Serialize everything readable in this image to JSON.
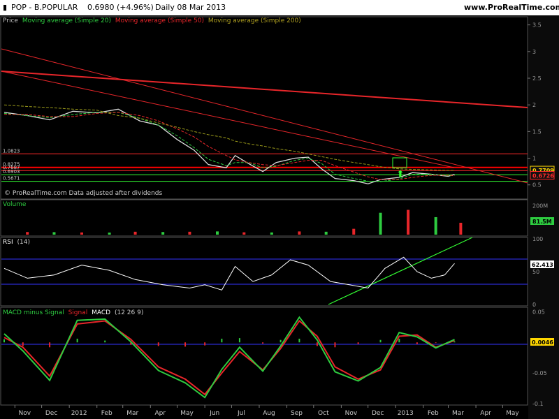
{
  "topbar": {
    "symbol": "POP - B.POPULAR",
    "last": "0.6980 (+4.96%)",
    "period_date": "Daily  08 Mar 2013",
    "site": "www.ProRealTime.com"
  },
  "price_panel": {
    "title_price": "Price",
    "title_ma20": "Moving average (Simple 20)",
    "title_ma50": "Moving average (Simple 50)",
    "title_ma200": "Moving average (Simple 200)",
    "footer": "© ProRealTime.com  Data adjusted after dividends",
    "y_ticks": [
      "3.5",
      "3",
      "2.5",
      "2",
      "1.5",
      "1",
      "0.5"
    ],
    "hlines": [
      {
        "label": "1.0823",
        "value": 1.0823,
        "color": "#ff2a2a"
      },
      {
        "label": "0.8275",
        "value": 0.8275,
        "color": "#ff0000"
      },
      {
        "label": "0.7687",
        "value": 0.7687,
        "color": "#ff2a2a"
      },
      {
        "label": "0.6903",
        "value": 0.6903,
        "color": "#33ff33"
      },
      {
        "label": "0.5671",
        "value": 0.5671,
        "color": "#33ff33"
      }
    ],
    "badges": [
      {
        "text": "0.7709",
        "value": 0.7709,
        "color": "#ffd700"
      },
      {
        "text": "0.6726",
        "value": 0.6726,
        "color": "#ff2a2a"
      }
    ],
    "colors": {
      "ma20": "#2ecc40",
      "ma50": "#e8262a",
      "ma200": "#9a9a1a",
      "price": "#dddddd"
    }
  },
  "volume_panel": {
    "title": "Volume",
    "y_ticks": [
      "200M"
    ],
    "badge": "81.5M"
  },
  "rsi_panel": {
    "title": "RSI",
    "param": "(14)",
    "y_ticks": [
      "100",
      "50",
      "0"
    ],
    "badge": "62.413"
  },
  "macd_panel": {
    "title_hist": "MACD minus Signal",
    "title_signal": "Signal",
    "title_macd": "MACD",
    "param": "(12 26 9)",
    "y_ticks": [
      "0.05",
      "0",
      "-0.05",
      "-0.1"
    ],
    "badge": "0.0046"
  },
  "x_axis": {
    "labels": [
      "Nov",
      "Dec",
      "2012",
      "Feb",
      "Mar",
      "Apr",
      "May",
      "Jun",
      "Jul",
      "Aug",
      "Sep",
      "Oct",
      "Nov",
      "Dec",
      "2013",
      "Feb",
      "Mar",
      "Apr",
      "May"
    ]
  },
  "chart_data": [
    {
      "type": "line",
      "title": "",
      "xlabel": "",
      "ylabel": "",
      "ylim": [
        0.3,
        3.6
      ],
      "x": [
        "2011-10-20",
        "2011-11-15",
        "2011-12-10",
        "2012-01-05",
        "2012-02-01",
        "2012-02-25",
        "2012-03-20",
        "2012-04-10",
        "2012-05-01",
        "2012-05-20",
        "2012-06-05",
        "2012-06-25",
        "2012-07-05",
        "2012-07-20",
        "2012-08-05",
        "2012-08-20",
        "2012-09-10",
        "2012-09-25",
        "2012-10-10",
        "2012-10-25",
        "2012-11-15",
        "2012-12-01",
        "2012-12-15",
        "2013-01-05",
        "2013-01-20",
        "2013-02-10",
        "2013-03-01",
        "2013-03-08"
      ],
      "series": [
        {
          "values": [
            1.86,
            1.8,
            1.72,
            1.88,
            1.85,
            1.92,
            1.7,
            1.62,
            1.35,
            1.15,
            0.88,
            0.82,
            1.05,
            0.9,
            0.75,
            0.92,
            1.0,
            1.02,
            0.8,
            0.62,
            0.58,
            0.52,
            0.6,
            0.64,
            0.73,
            0.7,
            0.66,
            0.698
          ]
        },
        {
          "values": [
            1.84,
            1.8,
            1.76,
            1.82,
            1.86,
            1.86,
            1.75,
            1.62,
            1.42,
            1.2,
            0.98,
            0.86,
            0.92,
            0.92,
            0.82,
            0.85,
            0.96,
            1.0,
            0.9,
            0.7,
            0.62,
            0.57,
            0.56,
            0.61,
            0.7,
            0.7,
            0.67,
            0.6726
          ]
        },
        {
          "values": [
            1.82,
            1.82,
            1.78,
            1.78,
            1.84,
            1.86,
            1.8,
            1.7,
            1.55,
            1.4,
            1.22,
            1.05,
            0.97,
            0.92,
            0.88,
            0.86,
            0.92,
            0.96,
            0.96,
            0.86,
            0.74,
            0.65,
            0.6,
            0.6,
            0.64,
            0.68,
            0.68,
            0.6726
          ]
        },
        {
          "values": [
            2.0,
            1.97,
            1.95,
            1.92,
            1.9,
            1.8,
            1.75,
            1.66,
            1.58,
            1.5,
            1.44,
            1.38,
            1.32,
            1.27,
            1.23,
            1.18,
            1.13,
            1.08,
            1.03,
            0.98,
            0.92,
            0.88,
            0.84,
            0.8,
            0.79,
            0.78,
            0.771,
            0.7709
          ]
        }
      ]
    },
    {
      "type": "bar",
      "title": "",
      "ylim": [
        0,
        230
      ],
      "x": [
        "2011-11",
        "2011-12",
        "2012-01",
        "2012-02",
        "2012-03",
        "2012-04",
        "2012-05",
        "2012-06",
        "2012-07",
        "2012-08",
        "2012-09",
        "2012-10",
        "2012-11",
        "2012-12",
        "2013-01",
        "2013-02",
        "2013-03"
      ],
      "values": [
        18,
        17,
        15,
        14,
        20,
        18,
        20,
        22,
        16,
        15,
        22,
        20,
        40,
        150,
        170,
        120,
        81.5
      ]
    },
    {
      "type": "line",
      "title": "",
      "ylim": [
        0,
        100
      ],
      "x": [
        "2011-10-20",
        "2011-11-15",
        "2011-12-15",
        "2012-01-15",
        "2012-02-15",
        "2012-03-15",
        "2012-04-15",
        "2012-05-15",
        "2012-06-01",
        "2012-06-20",
        "2012-07-05",
        "2012-07-25",
        "2012-08-15",
        "2012-09-05",
        "2012-09-25",
        "2012-10-20",
        "2012-11-10",
        "2012-12-01",
        "2012-12-20",
        "2013-01-10",
        "2013-01-25",
        "2013-02-10",
        "2013-02-25",
        "2013-03-08"
      ],
      "series": [
        {
          "values": [
            55,
            40,
            45,
            60,
            52,
            38,
            30,
            25,
            30,
            22,
            58,
            35,
            45,
            68,
            60,
            35,
            30,
            25,
            55,
            72,
            50,
            40,
            45,
            62.413
          ]
        }
      ]
    },
    {
      "type": "bar",
      "title": "",
      "ylim": [
        -0.1,
        0.055
      ],
      "x": [
        "2011-10-20",
        "2011-11-10",
        "2011-12-10",
        "2012-01-10",
        "2012-02-10",
        "2012-03-10",
        "2012-04-10",
        "2012-05-10",
        "2012-06-01",
        "2012-06-20",
        "2012-07-10",
        "2012-08-05",
        "2012-08-25",
        "2012-09-15",
        "2012-10-05",
        "2012-10-25",
        "2012-11-20",
        "2012-12-15",
        "2013-01-05",
        "2013-01-25",
        "2013-02-15",
        "2013-03-08"
      ],
      "series": [
        {
          "name": "MACD minus Signal",
          "values": [
            0.005,
            -0.006,
            -0.008,
            0.006,
            0.003,
            -0.004,
            -0.006,
            -0.007,
            -0.005,
            0.006,
            0.007,
            -0.002,
            0.004,
            0.006,
            -0.006,
            -0.008,
            -0.003,
            0.004,
            0.006,
            -0.003,
            -0.001,
            0.0016
          ]
        },
        {
          "name": "Signal",
          "values": [
            0.008,
            -0.008,
            -0.055,
            0.03,
            0.035,
            0.005,
            -0.04,
            -0.06,
            -0.085,
            -0.05,
            -0.015,
            -0.045,
            -0.01,
            0.035,
            0.01,
            -0.04,
            -0.06,
            -0.045,
            0.01,
            0.012,
            -0.008,
            0.003
          ]
        },
        {
          "name": "MACD",
          "values": [
            0.014,
            -0.014,
            -0.062,
            0.036,
            0.038,
            0.001,
            -0.046,
            -0.066,
            -0.09,
            -0.044,
            -0.008,
            -0.047,
            -0.006,
            0.041,
            0.004,
            -0.048,
            -0.063,
            -0.041,
            0.016,
            0.009,
            -0.009,
            0.0046
          ]
        }
      ]
    }
  ]
}
